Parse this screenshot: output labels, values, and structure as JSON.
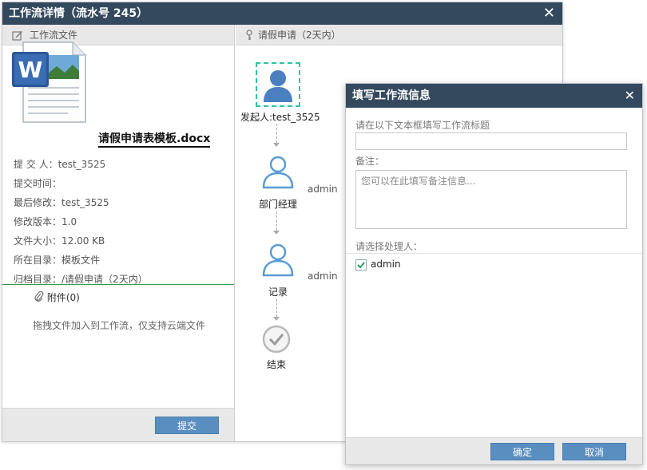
{
  "main_window": {
    "title": "工作流详情（流水号 245）",
    "close": "✕"
  },
  "left": {
    "section_title": "工作流文件",
    "file_name": "请假申请表模板.docx",
    "fields": [
      {
        "label": "提 交 人：",
        "value": "test_3525"
      },
      {
        "label": "提交时间：",
        "value": ""
      },
      {
        "label": "最后修改：",
        "value": "test_3525"
      },
      {
        "label": "修改版本：",
        "value": "1.0"
      },
      {
        "label": "文件大小：",
        "value": "12.00 KB"
      },
      {
        "label": "所在目录：",
        "value": "模板文件"
      },
      {
        "label": "归档目录：",
        "value": "/请假申请（2天内）"
      }
    ],
    "attachments_label": "附件(0)",
    "hint": "拖拽文件加入到工作流，仅支持云端文件",
    "submit_label": "提交"
  },
  "right": {
    "section_title": "请假申请（2天内）",
    "nodes": [
      {
        "label": "发起人:test_3525",
        "assignee": ""
      },
      {
        "label": "部门经理",
        "assignee": "admin"
      },
      {
        "label": "记录",
        "assignee": "admin"
      },
      {
        "label": "结束",
        "assignee": ""
      }
    ]
  },
  "dialog": {
    "title": "填写工作流信息",
    "close": "✕",
    "title_field_label": "请在以下文本框填写工作流标题",
    "title_value": "",
    "note_label": "备注：",
    "note_placeholder": "您可以在此填写备注信息...",
    "assignee_label": "请选择处理人：",
    "assignee_option": "admin",
    "ok_label": "确定",
    "cancel_label": "取消"
  },
  "colors": {
    "titlebar": "#34495e",
    "button": "#5a8ec0",
    "user_icon": "#4a7fc0",
    "selected_border": "#2ec4a0"
  }
}
